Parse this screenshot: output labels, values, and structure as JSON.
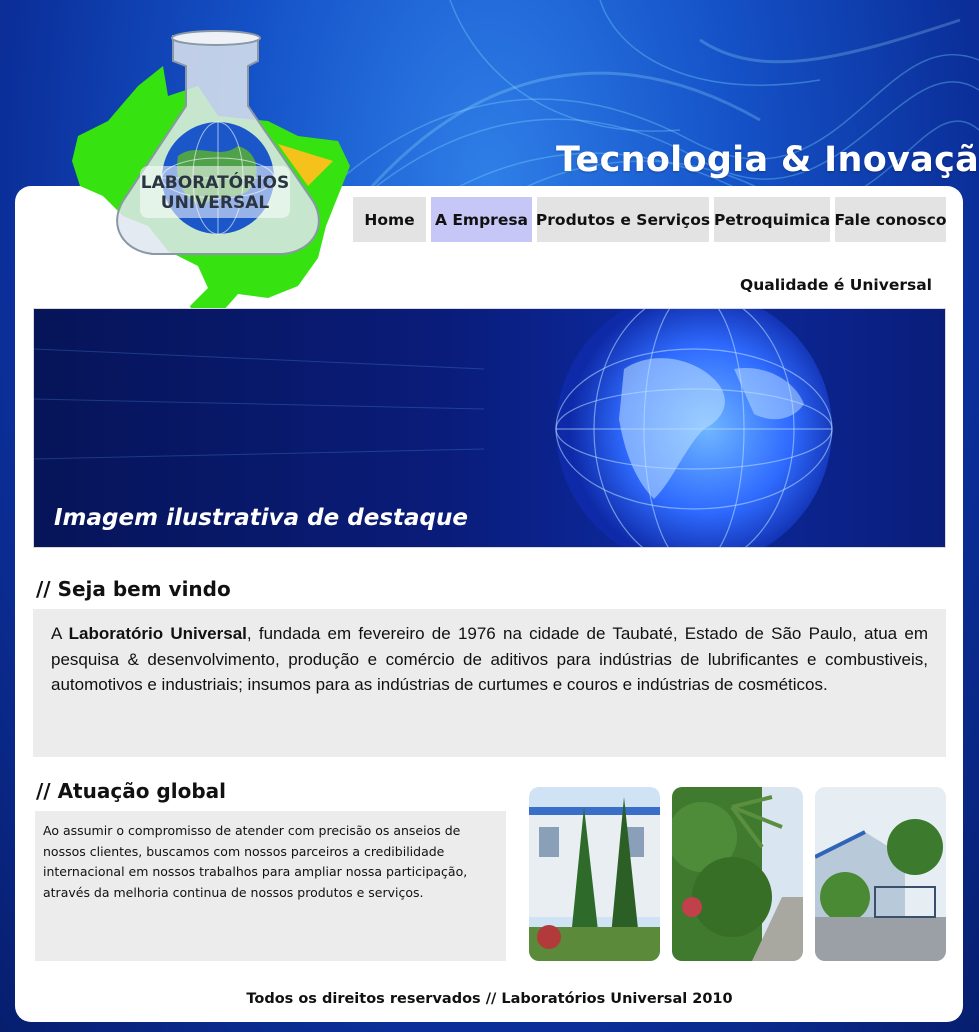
{
  "header": {
    "tagline": "Tecnologia & Inovação",
    "logo_text_line1": "LABORATÓRIOS",
    "logo_text_line2": "UNIVERSAL",
    "slogan": "Qualidade é Universal"
  },
  "nav": {
    "items": [
      {
        "label": "Home",
        "active": false
      },
      {
        "label": "A Empresa",
        "active": true
      },
      {
        "label": "Produtos e Serviços",
        "active": false
      },
      {
        "label": "Petroquimica",
        "active": false
      },
      {
        "label": "Fale conosco",
        "active": false
      }
    ]
  },
  "banner": {
    "caption": "Imagem ilustrativa de destaque"
  },
  "welcome": {
    "title": "// Seja bem vindo",
    "text_prefix": "A ",
    "company": "Laboratório Universal",
    "text_body": ", fundada em fevereiro de 1976 na cidade de Taubaté, Estado de São Paulo, atua em pesquisa & desenvolvimento, produção e comércio de aditivos para indústrias de lubrificantes e combustiveis, automotivos e industriais; insumos para as indústrias de curtumes e couros e indústrias de cosméticos."
  },
  "global": {
    "title": "// Atuação global",
    "text": "Ao assumir o compromisso de atender com precisão os anseios de nossos clientes, buscamos com nossos parceiros a credibilidade internacional em nossos trabalhos para ampliar nossa participação, através da melhoria continua de nossos produtos e serviços."
  },
  "footer": {
    "text": "Todos os direitos reservados // Laboratórios Universal 2010"
  },
  "colors": {
    "background": "#1553c9",
    "nav_active": "#c7c7f7",
    "nav_default": "#e3e3e3",
    "box_gray": "#ececec"
  }
}
